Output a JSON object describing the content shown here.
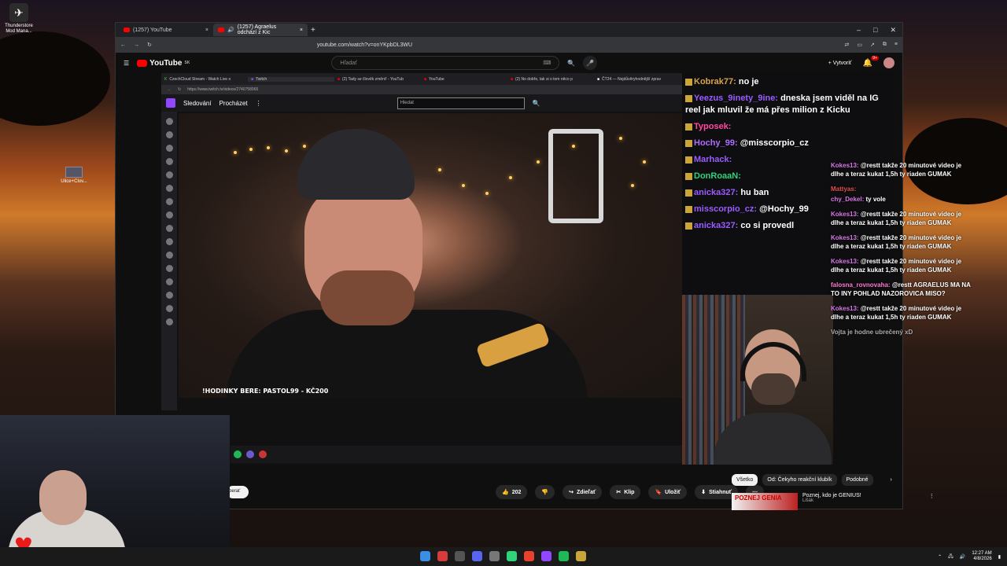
{
  "desktop": {
    "icons": [
      {
        "label": "Thunderstore Mod Mana..."
      },
      {
        "label": "Ulice+Clov..."
      }
    ]
  },
  "browser": {
    "tabs": [
      {
        "label": "(1257) YouTube"
      },
      {
        "label": "(1257) Agraelus odchází z Kic"
      }
    ],
    "url": "youtube.com/watch?v=onYKpbDL3WU"
  },
  "youtube": {
    "logo": "YouTube",
    "logo_sup": "SK",
    "search_placeholder": "Hľadať",
    "create_label": "Vytvoriť",
    "notif_count": "9+",
    "actions": {
      "likes": "202",
      "share": "Zdieľať",
      "clip": "Klip",
      "save": "Uložiť",
      "download": "Stiahnuť"
    },
    "chips": [
      "Všetko",
      "Od: Čekyho reakční klubík",
      "Podobné"
    ],
    "recommendation": {
      "thumb_text": "POZNEJ GENIA",
      "title": "Poznej, kdo je GENIUS!",
      "channel": "Lišák"
    },
    "left_chip": "berať"
  },
  "inner_browser": {
    "tabs": [
      "CzechCloud Stream - Watch Live o",
      "Twitch",
      "(2) Tady se člověk změní! - YouTub",
      "YouTube",
      "(2) No dobře, tak si o tom něco p",
      "ČT24 — Nejdůvěryhodnější zprav"
    ],
    "url": "https://www.twitch.tv/videos/2740758965"
  },
  "twitch": {
    "nav": [
      "Sledování",
      "Procházet"
    ],
    "search_placeholder": "Hledat",
    "overlay_text": "!HODINKY BERE: PASTOL99 - KČ200"
  },
  "chat": {
    "messages": [
      {
        "user": "Kobrak77:",
        "text": "no je",
        "color": "#d8a44a"
      },
      {
        "user": "Yeezus_9inety_9ine:",
        "text": "dneska jsem viděl na IG reel jak mluvil že má přes milion z Kicku",
        "color": "#9a5cff"
      },
      {
        "user": "Typosek:",
        "text": "",
        "color": "#ff4aa0"
      },
      {
        "user": "Hochy_99:",
        "text": "@misscorpio_cz",
        "color": "#b06cff"
      },
      {
        "user": "Marhack:",
        "text": "",
        "color": "#9a5cff"
      },
      {
        "user": "DonRoaaN:",
        "text": "",
        "color": "#2fd37a"
      },
      {
        "user": "anicka327:",
        "text": "hu ban",
        "color": "#9a5cff"
      },
      {
        "user": "misscorpio_cz:",
        "text": "@Hochy_99",
        "color": "#9a5cff"
      },
      {
        "user": "anicka327:",
        "text": "co si provedl",
        "color": "#9a5cff"
      }
    ]
  },
  "overlay_chat": [
    {
      "user": "Kokes13:",
      "text": "@restt takže 20 minutové video je dlhe a teraz kukat 1,5h ty riaden GUMAK"
    },
    {
      "user": "Mattyas:",
      "text": ""
    },
    {
      "user": "chy_Dekel:",
      "text": "ty vole"
    },
    {
      "user": "Kokes13:",
      "text": "@restt takže 20 minutové video je dlhe a teraz kukat 1,5h ty riaden GUMAK"
    },
    {
      "user": "Kokes13:",
      "text": "@restt takže 20 minutové video je dlhe a teraz kukat 1,5h ty riaden GUMAK"
    },
    {
      "user": "Kokes13:",
      "text": "@restt takže 20 minutové video je dlhe a teraz kukat 1,5h ty riaden GUMAK"
    },
    {
      "user": "falosna_rovnovaha:",
      "text": "@restt AGRAELUS MA NA TO INY POHLAD NAZOROVICA MISO?"
    },
    {
      "user": "Kokes13:",
      "text": "@restt takže 20 minutové video je dlhe a teraz kukat 1,5h ty riaden GUMAK"
    },
    {
      "user": "",
      "text": "Vojta je hodne ubrečený xD"
    }
  ],
  "taskbar": {
    "time": "12:27 AM",
    "date": "4/8/2026"
  }
}
